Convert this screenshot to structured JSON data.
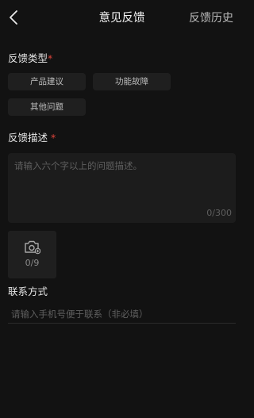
{
  "header": {
    "title": "意见反馈",
    "history_label": "反馈历史"
  },
  "type_section": {
    "label": "反馈类型",
    "required_mark": "*",
    "chips": [
      {
        "label": "产品建议"
      },
      {
        "label": "功能故障"
      },
      {
        "label": "其他问题"
      }
    ]
  },
  "desc_section": {
    "label": "反馈描述 ",
    "required_mark": "*",
    "placeholder": "请输入六个字以上的问题描述。",
    "count": "0/300"
  },
  "upload": {
    "count": "0/9",
    "icon": "camera-add-icon"
  },
  "contact_section": {
    "label": "联系方式",
    "placeholder": "请输入手机号便于联系（非必填）"
  },
  "colors": {
    "background": "#121212",
    "required": "#e0443b",
    "chip_bg": "#1f1f1f",
    "placeholder": "#5f5f5f"
  }
}
